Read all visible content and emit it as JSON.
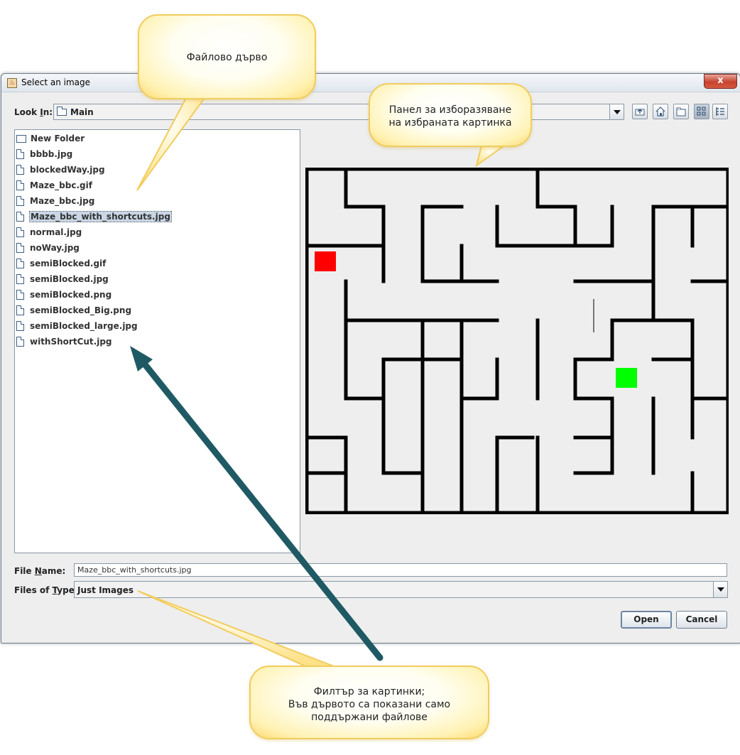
{
  "window": {
    "title": "Select an image",
    "close_label": "x"
  },
  "look_in": {
    "label_pre": "Look ",
    "label_mnemonic": "I",
    "label_post": "n:",
    "value": "Main"
  },
  "toolbar": {
    "icons": [
      "up-one-level-icon",
      "home-icon",
      "new-folder-icon",
      "list-view-icon",
      "details-view-icon"
    ]
  },
  "files": [
    {
      "name": "New Folder",
      "type": "folder"
    },
    {
      "name": "bbbb.jpg",
      "type": "file"
    },
    {
      "name": "blockedWay.jpg",
      "type": "file"
    },
    {
      "name": "Maze_bbc.gif",
      "type": "file"
    },
    {
      "name": "Maze_bbc.jpg",
      "type": "file"
    },
    {
      "name": "Maze_bbc_with_shortcuts.jpg",
      "type": "file",
      "selected": true
    },
    {
      "name": "normal.jpg",
      "type": "file"
    },
    {
      "name": "noWay.jpg",
      "type": "file"
    },
    {
      "name": "semiBlocked.gif",
      "type": "file"
    },
    {
      "name": "semiBlocked.jpg",
      "type": "file"
    },
    {
      "name": "semiBlocked.png",
      "type": "file"
    },
    {
      "name": "semiBlocked_Big.png",
      "type": "file"
    },
    {
      "name": "semiBlocked_large.jpg",
      "type": "file"
    },
    {
      "name": "withShortCut.jpg",
      "type": "file"
    }
  ],
  "file_name": {
    "label_pre": "File ",
    "label_mnemonic": "N",
    "label_post": "ame:",
    "value": "Maze_bbc_with_shortcuts.jpg"
  },
  "file_type": {
    "label_pre": "Files of ",
    "label_mnemonic": "T",
    "label_post": "ype:",
    "value": "Just Images"
  },
  "buttons": {
    "open": "Open",
    "cancel": "Cancel"
  },
  "colors": {
    "start_square": "#ff0000",
    "goal_square": "#00ff00",
    "callout_border": "#f1cc5e",
    "arrow": "#1f5a64"
  },
  "callouts": {
    "file_tree": "Файлово дърво",
    "preview_line1": "Панел за изборазяване",
    "preview_line2": "на избраната картинка",
    "filter_line1": "Филтър за картинки;",
    "filter_line2": "Във дървото са показани само",
    "filter_line3": "поддържани файлове"
  }
}
